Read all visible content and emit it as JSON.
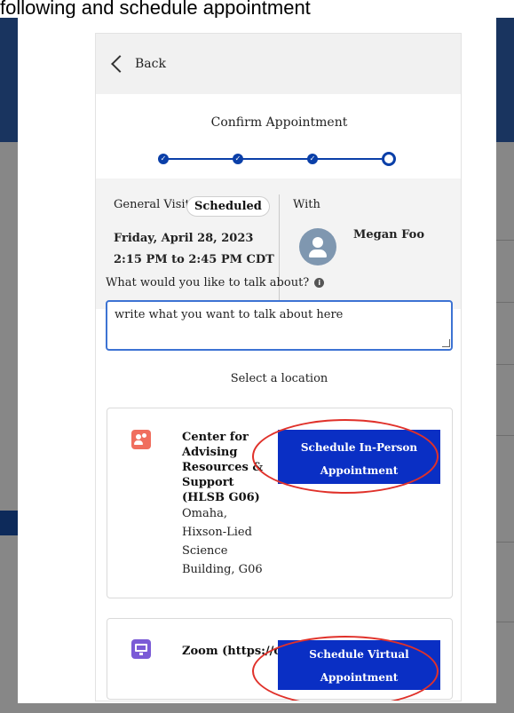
{
  "background": {
    "caption": "following and schedule appointment"
  },
  "back": {
    "label": "Back"
  },
  "title": "Confirm Appointment",
  "stepper": {
    "total_steps": 4,
    "current_step": 4
  },
  "appointment": {
    "visit_type": "General Visit",
    "status": "Scheduled",
    "date": "Friday, April 28, 2023",
    "time": "2:15 PM to 2:45 PM CDT",
    "with_label": "With",
    "advisor": "Megan Foo"
  },
  "topic": {
    "label": "What would you like to talk about?",
    "value": "write what you want to talk about here"
  },
  "locations": {
    "heading": "Select a location",
    "in_person": {
      "name": "Center for Advising Resources & Support (HLSB G06)",
      "address": "Omaha, Hixson-Lied Science Building, G06",
      "button": "Schedule In-Person Appointment"
    },
    "virtual": {
      "name": "Zoom (https://creighton.zoom.us/...o)",
      "button": "Schedule Virtual Appointment"
    }
  },
  "colors": {
    "accent": "#0a2fc4",
    "stepper": "#0a3fa8",
    "annotation": "#e0312a",
    "in_person_icon": "#f06e5e",
    "virtual_icon": "#7b5bd6"
  },
  "icons": [
    "chevron-left-icon",
    "check-icon",
    "info-icon",
    "user-avatar-icon",
    "people-icon",
    "monitor-icon",
    "resize-grip-icon"
  ]
}
